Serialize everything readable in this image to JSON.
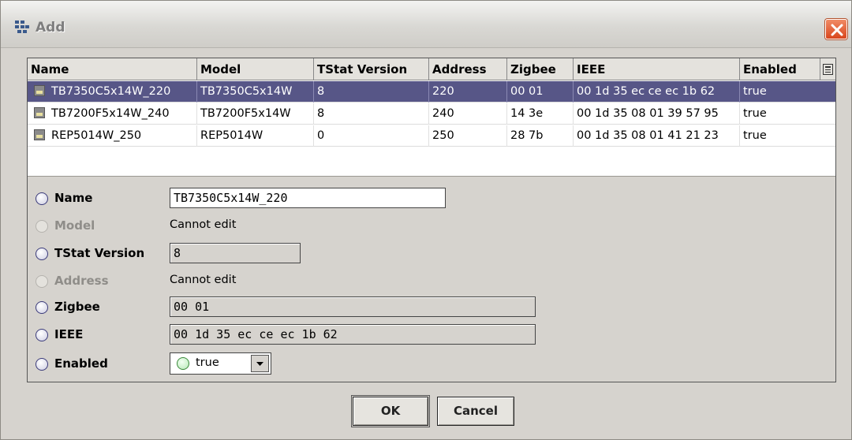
{
  "window": {
    "title": "Add",
    "icon": "network-icon",
    "close_icon": "close-icon"
  },
  "table": {
    "columns": [
      "Name",
      "Model",
      "TStat Version",
      "Address",
      "Zigbee",
      "IEEE",
      "Enabled"
    ],
    "column_menu_icon": "column-chooser-icon",
    "rows": [
      {
        "name": "TB7350C5x14W_220",
        "model": "TB7350C5x14W",
        "tstat_version": "8",
        "address": "220",
        "zigbee": "00 01",
        "ieee": "00 1d 35 ec ce ec 1b 62",
        "enabled": "true",
        "selected": true
      },
      {
        "name": "TB7200F5x14W_240",
        "model": "TB7200F5x14W",
        "tstat_version": "8",
        "address": "240",
        "zigbee": "14 3e",
        "ieee": "00 1d 35 08 01 39 57 95",
        "enabled": "true",
        "selected": false
      },
      {
        "name": "REP5014W_250",
        "model": "REP5014W",
        "tstat_version": "0",
        "address": "250",
        "zigbee": "28 7b",
        "ieee": "00 1d 35 08 01 41 21 23",
        "enabled": "true",
        "selected": false
      }
    ]
  },
  "form": {
    "name": {
      "label": "Name",
      "value": "TB7350C5x14W_220"
    },
    "model": {
      "label": "Model",
      "text": "Cannot edit"
    },
    "tstat_version": {
      "label": "TStat Version",
      "value": "8"
    },
    "address": {
      "label": "Address",
      "text": "Cannot edit"
    },
    "zigbee": {
      "label": "Zigbee",
      "value": "00 01"
    },
    "ieee": {
      "label": "IEEE",
      "value": "00 1d 35 ec ce ec 1b 62"
    },
    "enabled": {
      "label": "Enabled",
      "value": "true"
    }
  },
  "buttons": {
    "ok": "OK",
    "cancel": "Cancel"
  },
  "colors": {
    "selection": "#575687",
    "dialog_bg": "#d6d3ce",
    "close_button": "#d9461c"
  }
}
